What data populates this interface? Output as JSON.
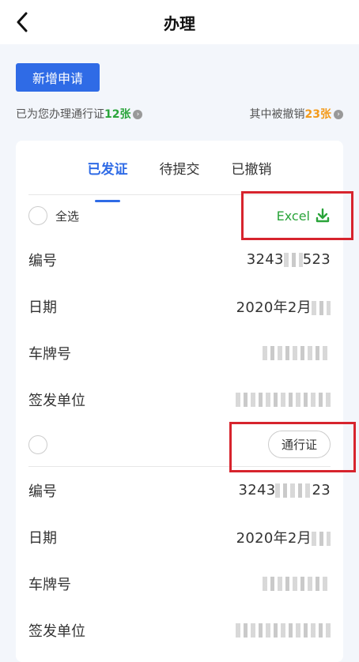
{
  "header": {
    "title": "办理"
  },
  "actions": {
    "new_application": "新增申请"
  },
  "summary": {
    "issued_prefix": "已为您办理通行证",
    "issued_count": "12张",
    "revoked_prefix": "其中被撤销",
    "revoked_count": "23张"
  },
  "tabs": [
    {
      "label": "已发证",
      "active": true
    },
    {
      "label": "待提交",
      "active": false
    },
    {
      "label": "已撤销",
      "active": false
    }
  ],
  "list": {
    "select_all_label": "全选",
    "export_label": "Excel",
    "pass_button_label": "通行证",
    "field_labels": {
      "number": "编号",
      "date": "日期",
      "plate": "车牌号",
      "issuer": "签发单位"
    },
    "records": [
      {
        "number_visible_prefix": "3243",
        "number_visible_suffix": "523",
        "date_visible": "2020年2月"
      },
      {
        "number_visible_prefix": "3243",
        "number_visible_suffix": "23",
        "date_visible": "2020年2月"
      }
    ]
  },
  "colors": {
    "primary": "#2f6be6",
    "success": "#2aa43a",
    "warning": "#f39a1a",
    "highlight_box": "#d7242d"
  }
}
